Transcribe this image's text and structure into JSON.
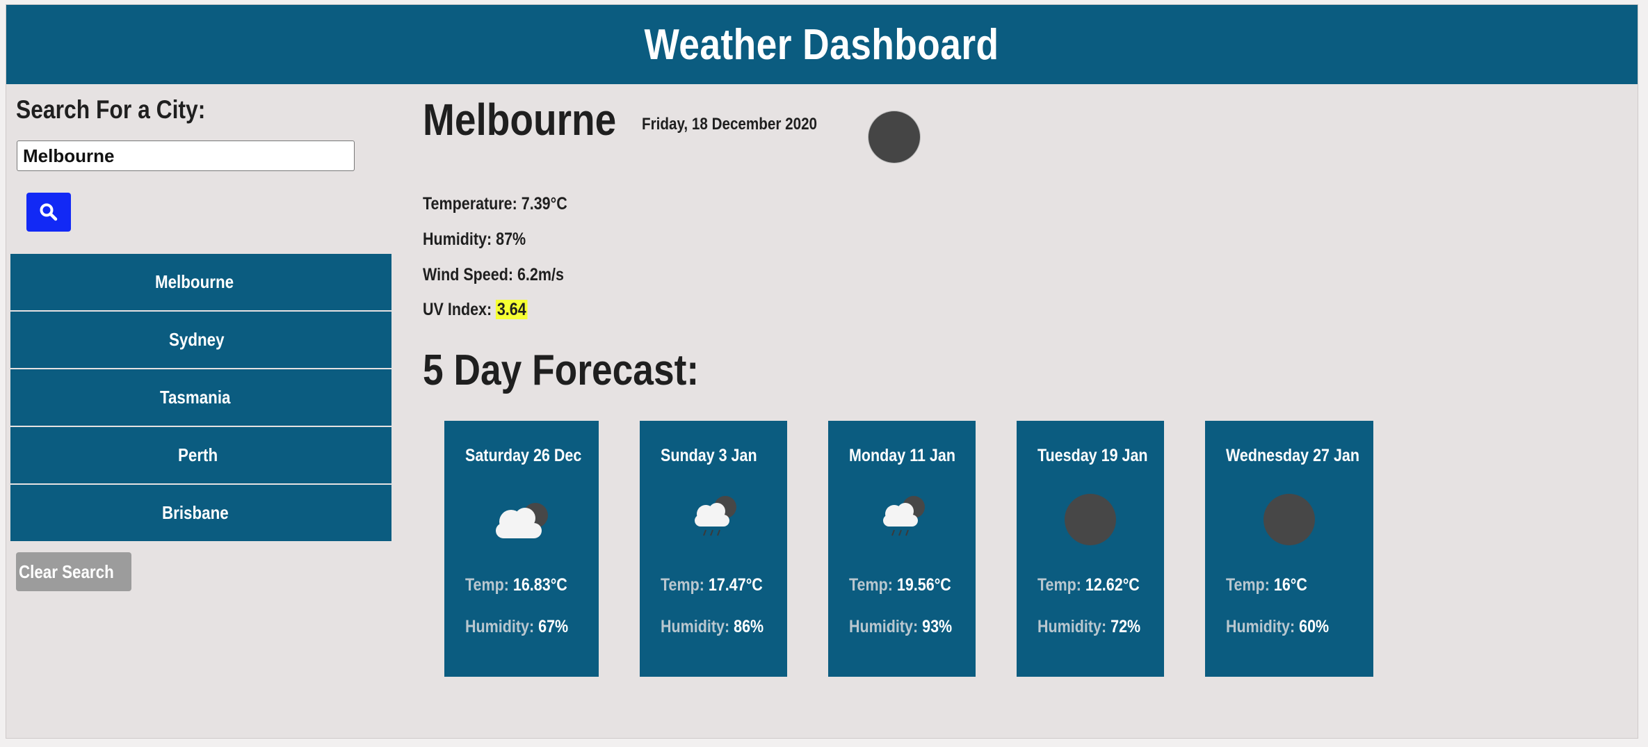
{
  "header": {
    "title": "Weather Dashboard"
  },
  "search": {
    "title": "Search For a City:",
    "value": "Melbourne",
    "button_icon": "search-icon",
    "history": [
      "Melbourne",
      "Sydney",
      "Tasmania",
      "Perth",
      "Brisbane"
    ],
    "clear_label": "Clear Search"
  },
  "current": {
    "city": "Melbourne",
    "date": "Friday, 18 December 2020",
    "icon": "moon-icon",
    "temperature": "Temperature: 7.39°C",
    "humidity": "Humidity: 87%",
    "wind": "Wind Speed: 6.2m/s",
    "uv_label": "UV Index:",
    "uv_value": "3.64"
  },
  "forecast": {
    "title": "5 Day Forecast:",
    "temp_label": "Temp:",
    "humidity_label": "Humidity:",
    "days": [
      {
        "day": "Saturday 26 Dec",
        "icon": "cloudy-night-icon",
        "temp": "16.83°C",
        "humidity": "67%"
      },
      {
        "day": "Sunday 3 Jan",
        "icon": "rain-night-icon",
        "temp": "17.47°C",
        "humidity": "86%"
      },
      {
        "day": "Monday 11 Jan",
        "icon": "rain-night-icon",
        "temp": "19.56°C",
        "humidity": "93%"
      },
      {
        "day": "Tuesday 19 Jan",
        "icon": "moon-icon",
        "temp": "12.62°C",
        "humidity": "72%"
      },
      {
        "day": "Wednesday 27 Jan",
        "icon": "moon-icon",
        "temp": "16°C",
        "humidity": "60%"
      }
    ]
  },
  "colors": {
    "header_bg": "#0b5c80",
    "search_button": "#1229f5",
    "uv_highlight": "#f6ff33",
    "clear_button": "#9c9c9c",
    "page_bg": "#e6e2e2"
  }
}
